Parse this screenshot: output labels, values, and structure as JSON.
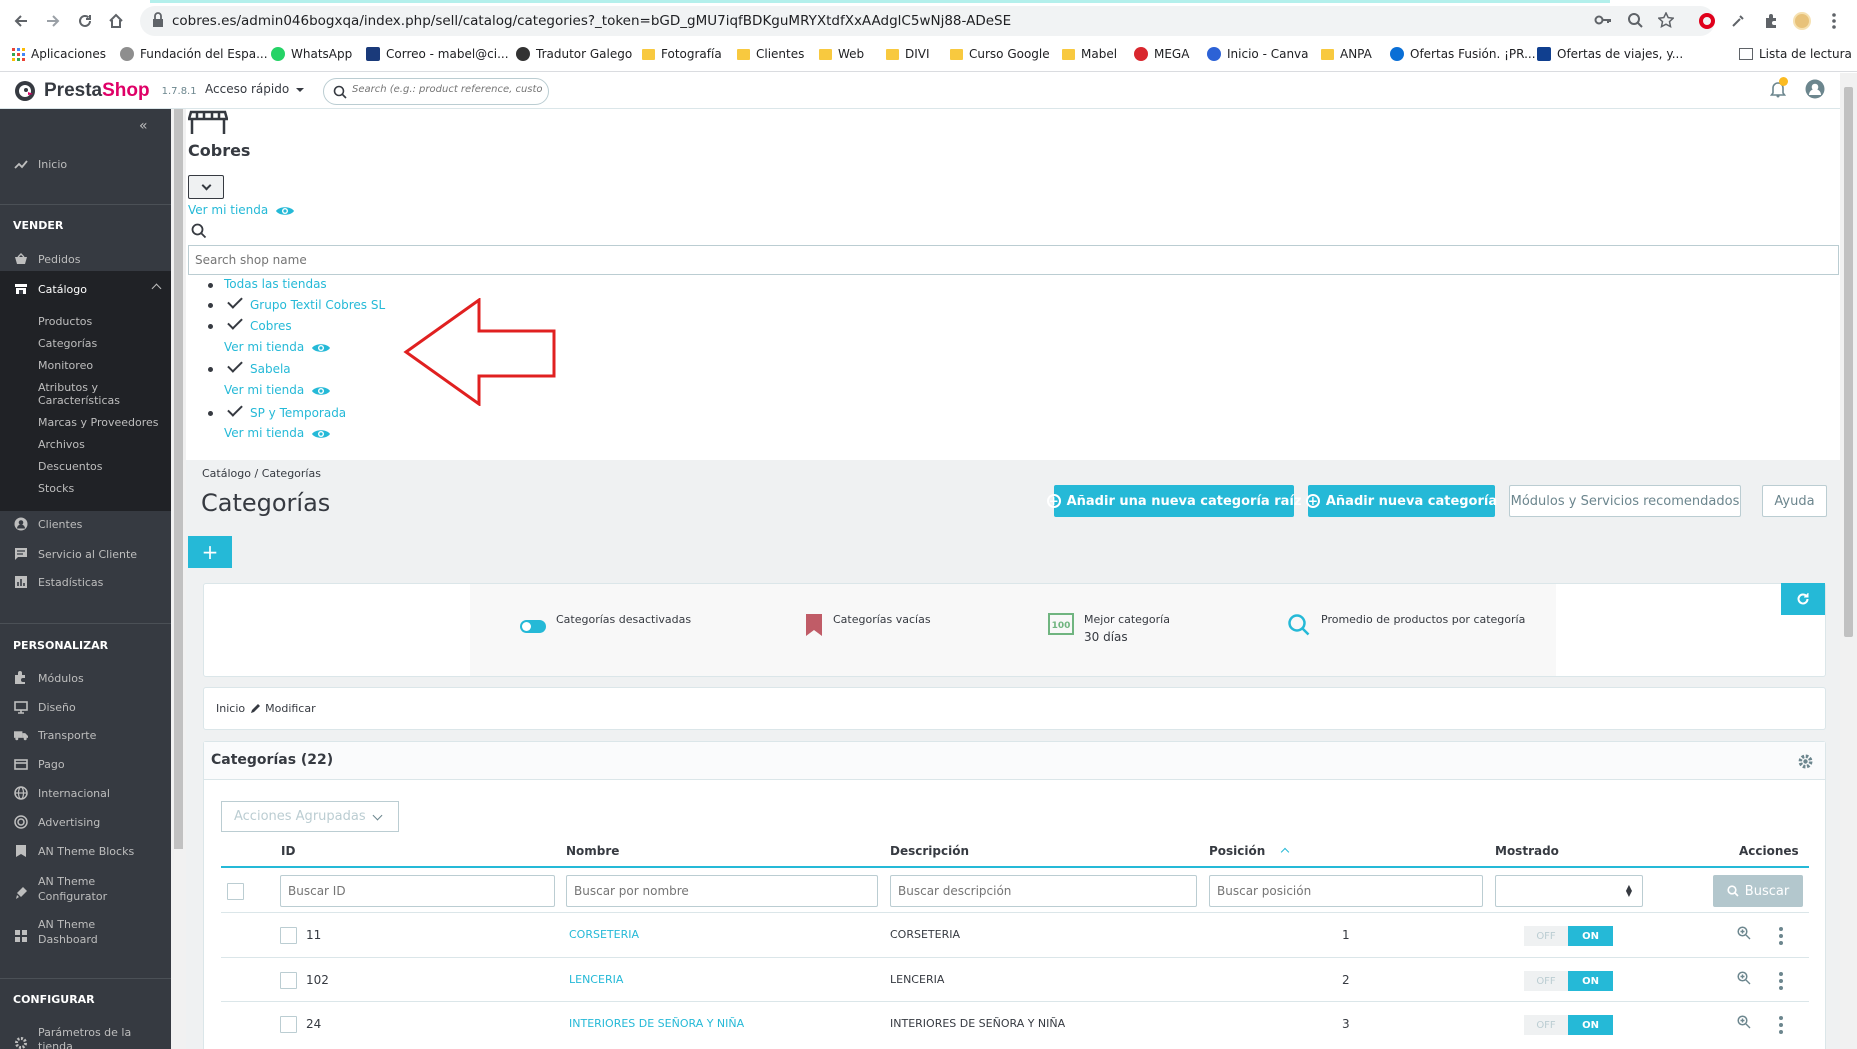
{
  "browser": {
    "url": "cobres.es/admin046bogxqa/index.php/sell/catalog/categories?_token=bGD_gMU7iqfBDKguMRYXtdfXxAAdglC5wNj88-ADeSE",
    "bookmarks": [
      "Aplicaciones",
      "Fundación del Espa...",
      "WhatsApp",
      "Correo - mabel@ci...",
      "Tradutor Galego",
      "Fotografía",
      "Clientes",
      "Web",
      "DIVI",
      "Curso Google",
      "Mabel",
      "MEGA",
      "Inicio - Canva",
      "ANPA",
      "Ofertas Fusión. ¡PR...",
      "Ofertas de viajes, y..."
    ],
    "reading_list": "Lista de lectura"
  },
  "header": {
    "brand_a": "Presta",
    "brand_b": "Shop",
    "version": "1.7.8.1",
    "quick_access": "Acceso rápido",
    "search_placeholder": "Search (e.g.: product reference, custome"
  },
  "sidebar": {
    "inicio": "Inicio",
    "vender": "VENDER",
    "pedidos": "Pedidos",
    "catalogo": "Catálogo",
    "catalog_subs": [
      "Productos",
      "Categorías",
      "Monitoreo",
      "Atributos y",
      "Características",
      "Marcas y Proveedores",
      "Archivos",
      "Descuentos",
      "Stocks"
    ],
    "clientes": "Clientes",
    "servicio": "Servicio al Cliente",
    "estadisticas": "Estadísticas",
    "personalizar": "PERSONALIZAR",
    "modulos": "Módulos",
    "diseno": "Diseño",
    "transporte": "Transporte",
    "pago": "Pago",
    "internacional": "Internacional",
    "advertising": "Advertising",
    "an_blocks": "AN Theme Blocks",
    "an_config_1": "AN Theme",
    "an_config_2": "Configurator",
    "an_dash_1": "AN Theme",
    "an_dash_2": "Dashboard",
    "configurar": "CONFIGURAR",
    "parametros_1": "Parámetros de la",
    "parametros_2": "tienda"
  },
  "shop": {
    "name": "Cobres",
    "view_store": "Ver mi tienda",
    "search_placeholder": "Search shop name",
    "all_shops": "Todas las tiendas",
    "tree": [
      "Grupo Textil Cobres SL",
      "Cobres",
      "Sabela",
      "SP y Temporada"
    ]
  },
  "page": {
    "breadcrumb_1": "Catálogo",
    "breadcrumb_2": "Categorías",
    "title": "Categorías",
    "btn_root": "Añadir una nueva categoría raíz",
    "btn_new": "Añadir nueva categoría",
    "btn_modules": "Módulos y Servicios recomendados",
    "btn_help": "Ayuda"
  },
  "kpis": {
    "disabled": "Categorías desactivadas",
    "empty": "Categorías vacías",
    "best": "Mejor categoría",
    "best_value": "30 días",
    "avg": "Promedio de productos por categoría"
  },
  "crumbs": {
    "home": "Inicio",
    "edit": "Modificar"
  },
  "table": {
    "title": "Categorías (22)",
    "bulk": "Acciones Agrupadas",
    "headers": {
      "id": "ID",
      "name": "Nombre",
      "desc": "Descripción",
      "pos": "Posición",
      "shown": "Mostrado",
      "actions": "Acciones"
    },
    "filters": {
      "id": "Buscar ID",
      "name": "Buscar por nombre",
      "desc": "Buscar descripción",
      "pos": "Buscar posición"
    },
    "search_btn": "Buscar",
    "off": "OFF",
    "on": "ON",
    "rows": [
      {
        "id": "11",
        "name": "CORSETERIA",
        "desc": "CORSETERIA",
        "pos": "1"
      },
      {
        "id": "102",
        "name": "LENCERIA",
        "desc": "LENCERIA",
        "pos": "2"
      },
      {
        "id": "24",
        "name": "INTERIORES DE SEÑORA Y NIÑA",
        "desc": "INTERIORES DE SEÑORA Y NIÑA",
        "pos": "3"
      }
    ]
  },
  "colors": {
    "accent": "#25b9d7",
    "sidebar": "#363a41",
    "brand": "#df0067",
    "annotation": "#e02020"
  }
}
